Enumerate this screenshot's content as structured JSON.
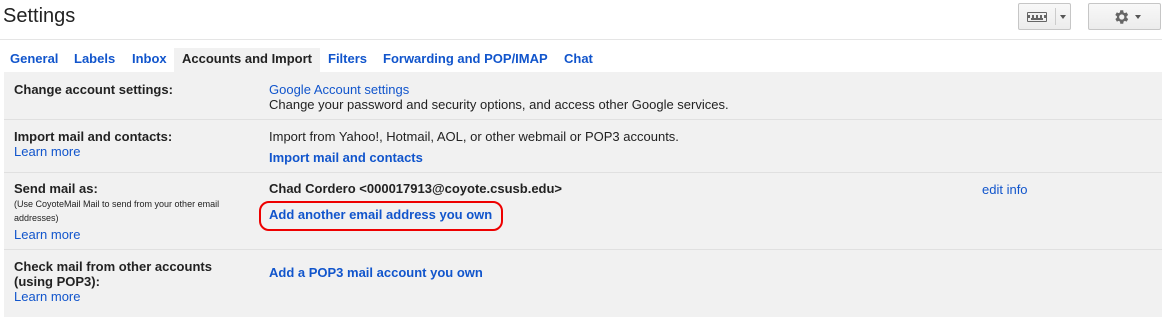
{
  "header": {
    "title": "Settings"
  },
  "toolbar": {
    "input_tools_icon": "keyboard-icon",
    "settings_icon": "gear-icon"
  },
  "tabs": [
    {
      "label": "General"
    },
    {
      "label": "Labels"
    },
    {
      "label": "Inbox"
    },
    {
      "label": "Accounts and Import",
      "active": true
    },
    {
      "label": "Filters"
    },
    {
      "label": "Forwarding and POP/IMAP"
    },
    {
      "label": "Chat"
    }
  ],
  "rows": {
    "change": {
      "label": "Change account settings:",
      "link": "Google Account settings",
      "desc": "Change your password and security options, and access other Google services."
    },
    "import": {
      "label": "Import mail and contacts:",
      "learn_more": "Learn more",
      "desc": "Import from Yahoo!, Hotmail, AOL, or other webmail or POP3 accounts.",
      "link": "Import mail and contacts"
    },
    "send": {
      "label": "Send mail as:",
      "note_line1": "(Use CoyoteMail Mail to send from your other email",
      "note_line2": "addresses)",
      "learn_more": "Learn more",
      "address": "Chad Cordero <000017913@coyote.csusb.edu>",
      "edit": "edit info",
      "add_link": "Add another email address you own"
    },
    "check": {
      "label_line1": "Check mail from other accounts",
      "label_line2": "(using POP3):",
      "learn_more": "Learn more",
      "add_link": "Add a POP3 mail account you own"
    }
  },
  "colors": {
    "link": "#1155cc",
    "highlight": "#ee0000",
    "panel_bg": "#f1f1f1"
  }
}
